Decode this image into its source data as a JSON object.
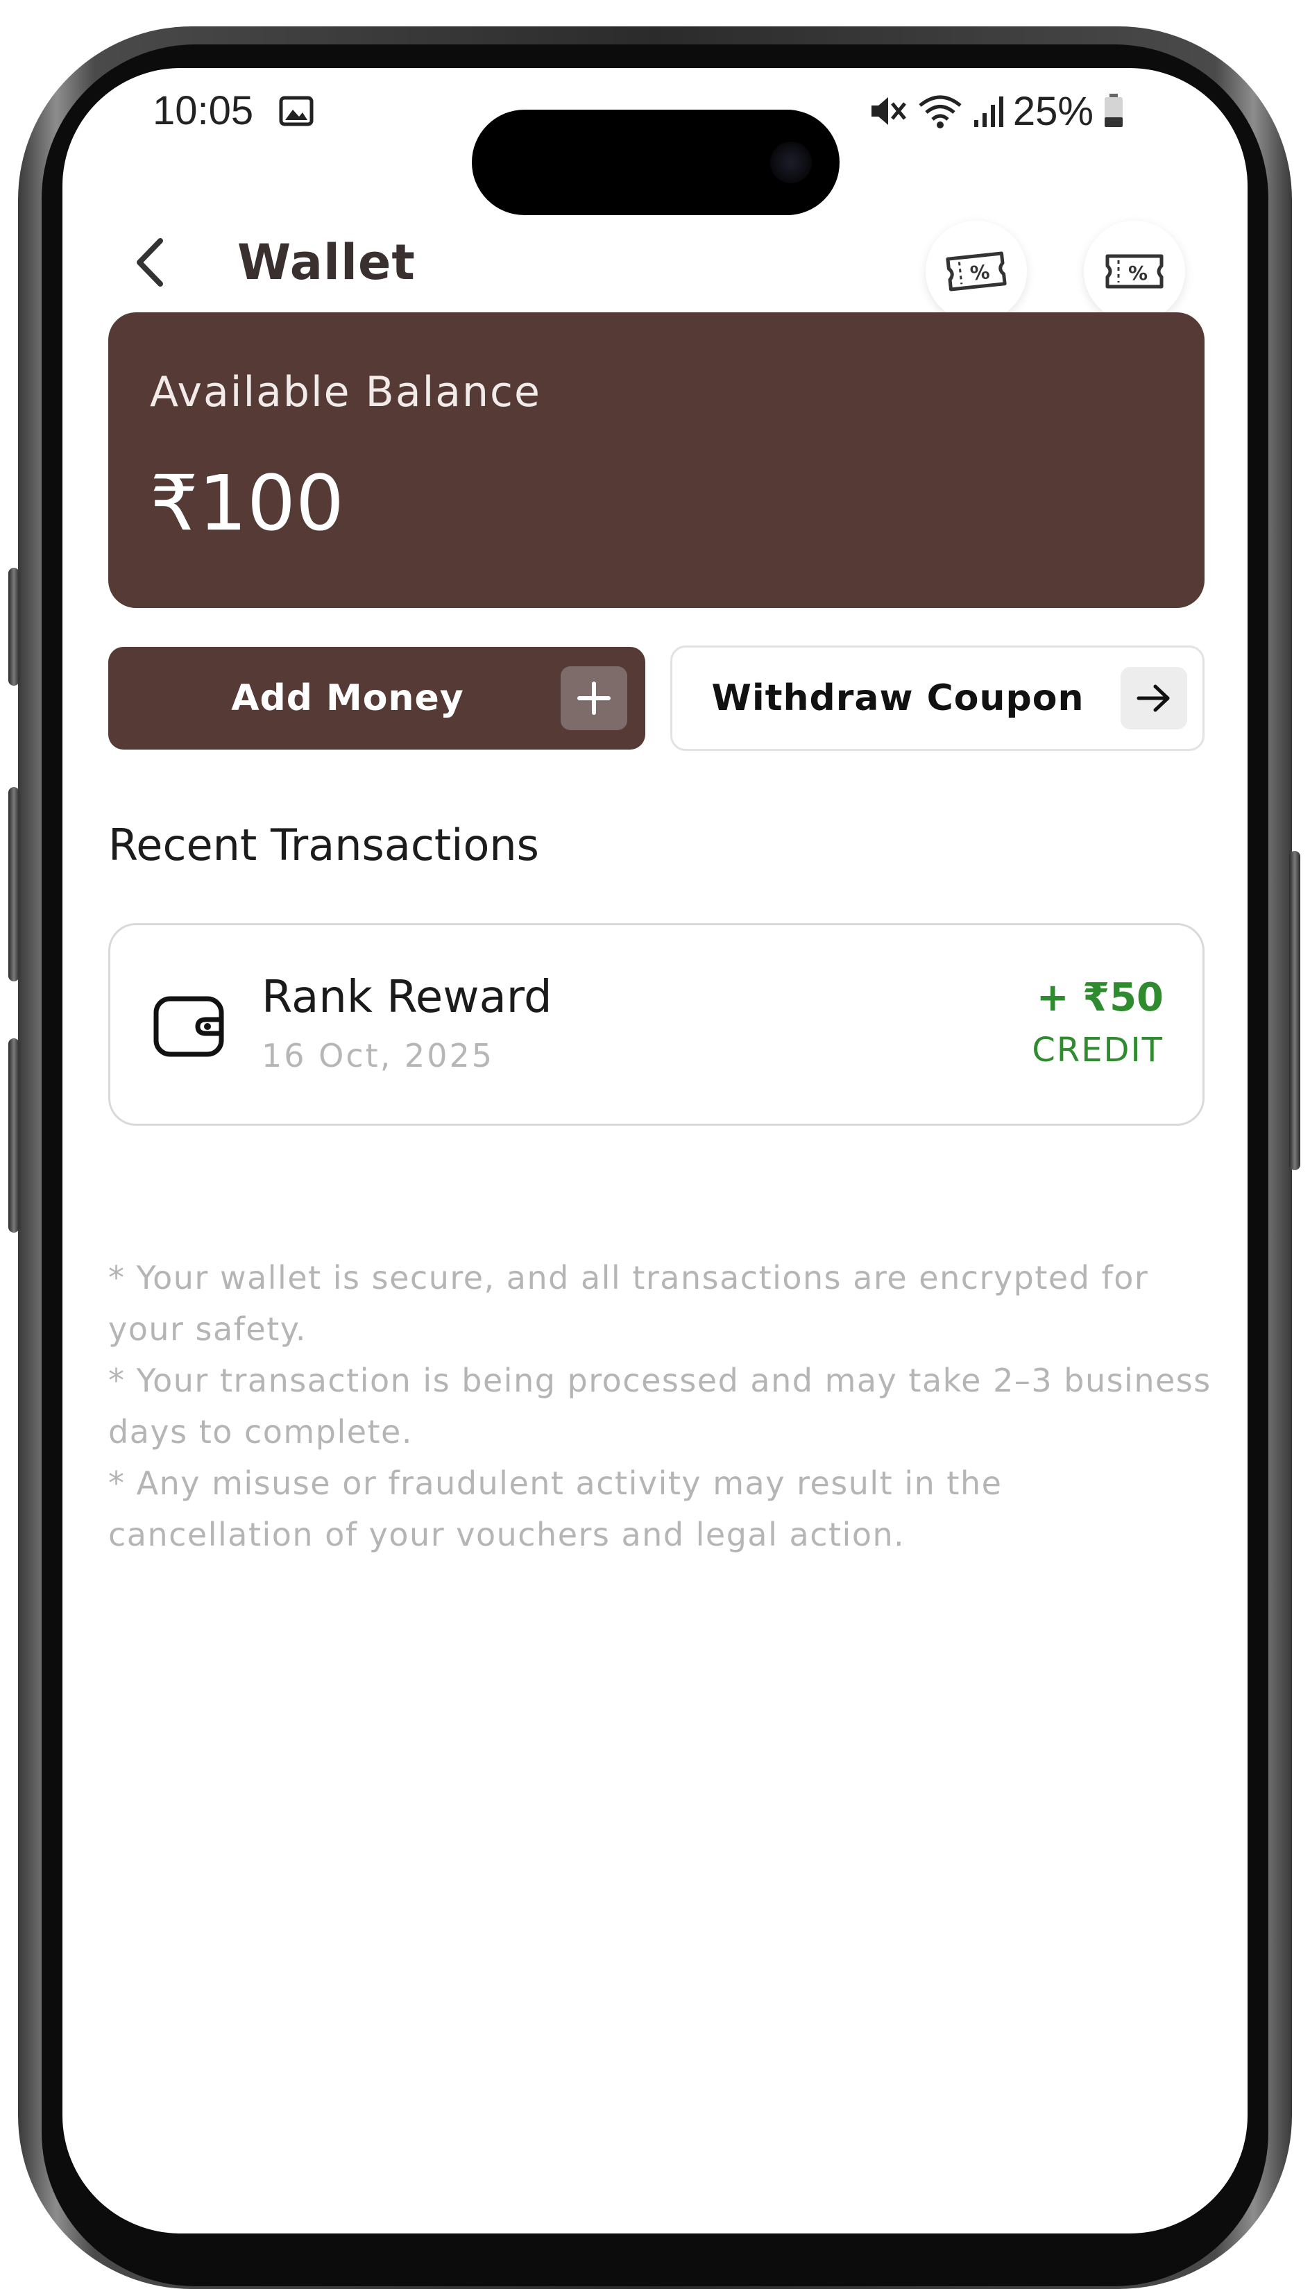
{
  "status_bar": {
    "time": "10:05",
    "battery": "25%"
  },
  "header": {
    "title": "Wallet",
    "back_icon": "chevron-left-icon",
    "action_icons": [
      "coupon-ticket-icon",
      "coupon-ticket-icon"
    ]
  },
  "balance": {
    "label": "Available Balance",
    "amount": "₹100"
  },
  "actions": {
    "add_money_label": "Add Money",
    "withdraw_label": "Withdraw Coupon"
  },
  "transactions": {
    "heading": "Recent Transactions",
    "items": [
      {
        "name": "Rank Reward",
        "date": "16 Oct, 2025",
        "amount": "+ ₹50",
        "type": "CREDIT",
        "icon": "wallet-icon"
      }
    ]
  },
  "notes": [
    "* Your wallet is secure, and all transactions are encrypted for your safety.",
    "* Your transaction is being processed and may take 2–3 business days to complete.",
    "* Any misuse or fraudulent activity may result in the cancellation of your vouchers and legal action."
  ],
  "colors": {
    "brand_brown": "#553a35",
    "credit_green": "#2e8b2e",
    "muted_text": "#b5b5b5"
  }
}
